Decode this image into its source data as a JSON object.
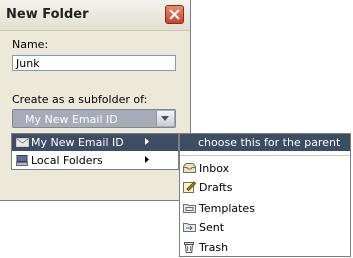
{
  "dialog": {
    "title": "New Folder",
    "name_label": "Name:",
    "name_value": "Junk",
    "subfolder_label": "Create as a subfolder of:",
    "parent_selected": "My New Email ID"
  },
  "menu": {
    "items": [
      {
        "label": "My New Email ID",
        "icon": "account-icon",
        "has_submenu": true,
        "selected": true
      },
      {
        "label": "Local Folders",
        "icon": "local-folders-icon",
        "has_submenu": true,
        "selected": false
      }
    ]
  },
  "submenu": {
    "header": "choose this for the parent",
    "items": [
      {
        "label": "Inbox",
        "icon": "inbox-icon"
      },
      {
        "label": "Drafts",
        "icon": "drafts-icon"
      },
      {
        "label": "Templates",
        "icon": "templates-icon"
      },
      {
        "label": "Sent",
        "icon": "sent-icon"
      },
      {
        "label": "Trash",
        "icon": "trash-icon"
      }
    ]
  },
  "colors": {
    "selection": "#3d4d63",
    "dialog_bg": "#ece9d8",
    "close_button": "#c4452b"
  }
}
